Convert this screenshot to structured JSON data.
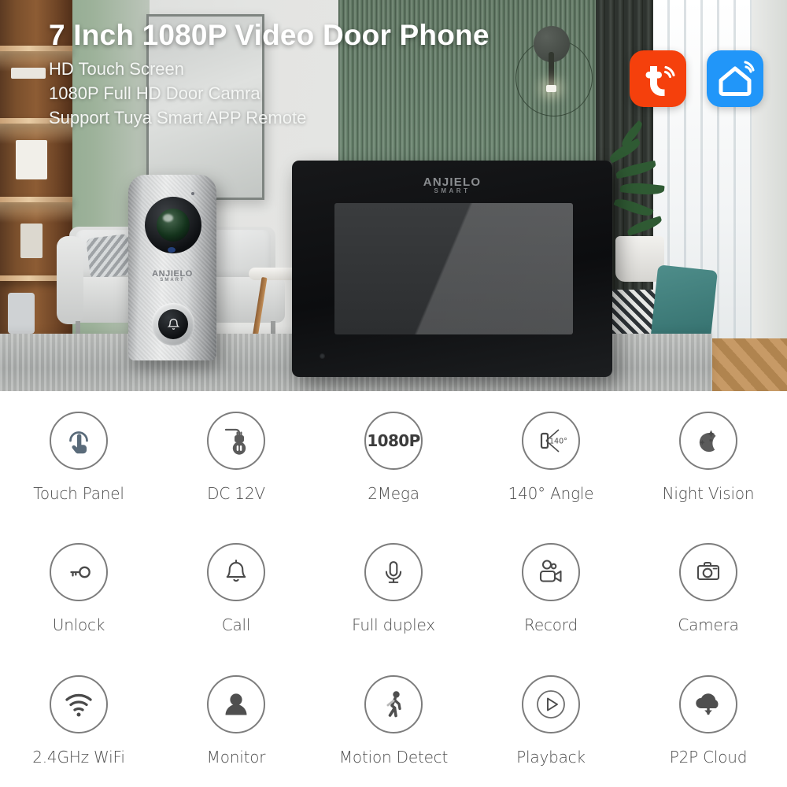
{
  "hero": {
    "title": "7 Inch 1080P Video Door Phone",
    "subtitle_lines": [
      "HD Touch Screen",
      "1080P Full HD Door Camra",
      "Support Tuya Smart APP Remote"
    ],
    "badges": [
      {
        "name": "tuya-app-badge",
        "label": "Tuya Smart",
        "color": "#f5400c",
        "icon": "tuya-t-wifi-icon"
      },
      {
        "name": "smart-life-app-badge",
        "label": "Smart Life",
        "color": "#2196f9",
        "icon": "house-wifi-icon"
      }
    ],
    "outdoor_unit": {
      "brand": "ANJIELO",
      "brand_sub": "SMART",
      "button_icon": "doorbell-bell-icon"
    },
    "indoor_monitor": {
      "brand": "ANJIELO",
      "brand_sub": "SMART"
    }
  },
  "features": [
    {
      "label": "Touch Panel",
      "icon": "touch-hand-icon"
    },
    {
      "label": "DC 12V",
      "icon": "power-plug-socket-icon"
    },
    {
      "label": "2Mega",
      "icon": "1080p-text-icon",
      "icon_text": "1080P"
    },
    {
      "label": "140° Angle",
      "icon": "view-angle-icon",
      "icon_text": "140°"
    },
    {
      "label": "Night Vision",
      "icon": "moon-stars-icon"
    },
    {
      "label": "Unlock",
      "icon": "key-icon"
    },
    {
      "label": "Call",
      "icon": "bell-icon"
    },
    {
      "label": "Full duplex",
      "icon": "microphone-icon"
    },
    {
      "label": "Record",
      "icon": "video-camera-icon"
    },
    {
      "label": "Camera",
      "icon": "photo-camera-icon"
    },
    {
      "label": "2.4GHz WiFi",
      "icon": "wifi-icon"
    },
    {
      "label": "Monitor",
      "icon": "person-icon"
    },
    {
      "label": "Motion Detect",
      "icon": "walking-person-icon"
    },
    {
      "label": "Playback",
      "icon": "play-circle-icon"
    },
    {
      "label": "P2P Cloud",
      "icon": "cloud-download-icon"
    }
  ],
  "colors": {
    "icon_stroke": "#7d7d7d",
    "label": "#4e4e4e",
    "tuya_orange": "#f5400c",
    "smartlife_blue": "#2196f9"
  }
}
